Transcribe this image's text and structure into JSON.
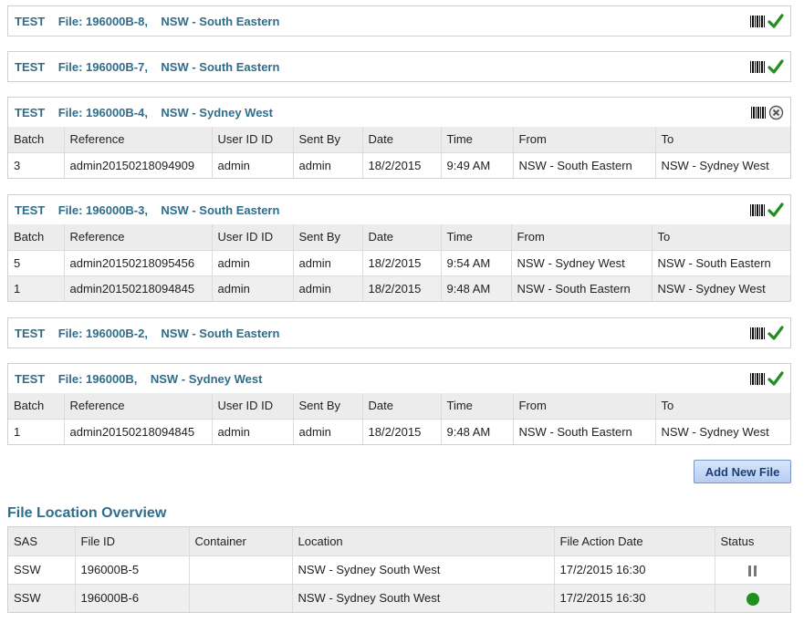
{
  "table_headers": [
    "Batch",
    "Reference",
    "User ID ID",
    "Sent By",
    "Date",
    "Time",
    "From",
    "To"
  ],
  "files": [
    {
      "test": "TEST",
      "file": "File: 196000B-8,",
      "region": "NSW - South Eastern",
      "status": "check-icon",
      "rows": []
    },
    {
      "test": "TEST",
      "file": "File: 196000B-7,",
      "region": "NSW - South Eastern",
      "status": "check-icon",
      "rows": []
    },
    {
      "test": "TEST",
      "file": "File: 196000B-4,",
      "region": "NSW - Sydney West",
      "status": "x-circle-icon",
      "rows": [
        [
          "3",
          "admin20150218094909",
          "admin",
          "admin",
          "18/2/2015",
          "9:49 AM",
          "NSW - South Eastern",
          "NSW - Sydney West"
        ]
      ]
    },
    {
      "test": "TEST",
      "file": "File: 196000B-3,",
      "region": "NSW - South Eastern",
      "status": "check-icon",
      "rows": [
        [
          "5",
          "admin20150218095456",
          "admin",
          "admin",
          "18/2/2015",
          "9:54 AM",
          "NSW - Sydney West",
          "NSW - South Eastern"
        ],
        [
          "1",
          "admin20150218094845",
          "admin",
          "admin",
          "18/2/2015",
          "9:48 AM",
          "NSW - South Eastern",
          "NSW - Sydney West"
        ]
      ]
    },
    {
      "test": "TEST",
      "file": "File: 196000B-2,",
      "region": "NSW - South Eastern",
      "status": "check-icon",
      "rows": []
    },
    {
      "test": "TEST",
      "file": "File: 196000B,",
      "region": "NSW - Sydney West",
      "status": "check-icon",
      "rows": [
        [
          "1",
          "admin20150218094845",
          "admin",
          "admin",
          "18/2/2015",
          "9:48 AM",
          "NSW - South Eastern",
          "NSW - Sydney West"
        ]
      ]
    }
  ],
  "add_button": "Add New File",
  "overview": {
    "title": "File Location Overview",
    "headers": [
      "SAS",
      "File ID",
      "Container",
      "Location",
      "File Action Date",
      "Status"
    ],
    "rows": [
      {
        "sas": "SSW",
        "file_id": "196000B-5",
        "container": "",
        "location": "NSW - Sydney South West",
        "date": "17/2/2015 16:30",
        "status": "pause-icon"
      },
      {
        "sas": "SSW",
        "file_id": "196000B-6",
        "container": "",
        "location": "NSW - Sydney South West",
        "date": "17/2/2015 16:30",
        "status": "green-dot-icon"
      }
    ]
  },
  "colors": {
    "title": "#2f6d8c",
    "check": "#1f8f1f",
    "header_bg": "#ececec"
  }
}
